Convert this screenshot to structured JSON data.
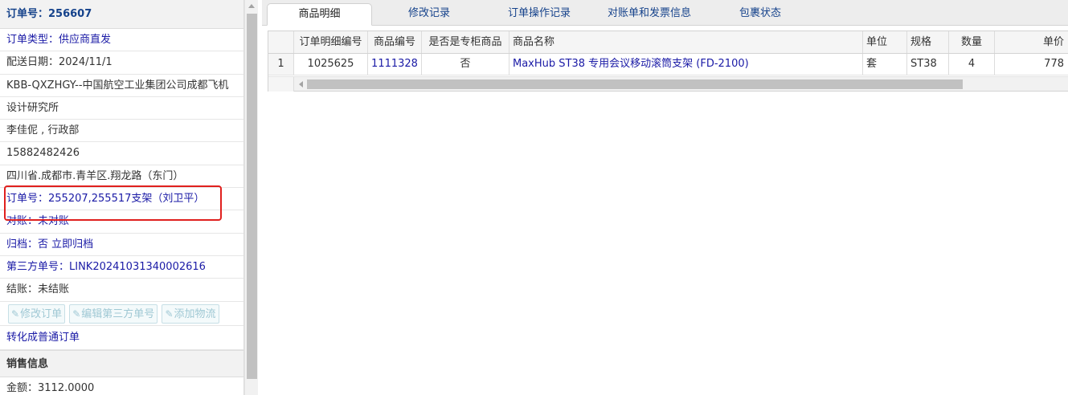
{
  "left_panel": {
    "order_header": "订单号：256607",
    "order_type": "订单类型：供应商直发",
    "delivery_date": "配送日期：2024/11/1",
    "customer_line1": "KBB-QXZHGY--中国航空工业集团公司成都飞机",
    "customer_line2": "设计研究所",
    "contact": "李佳伲 , 行政部",
    "phone": "15882482426",
    "address": "四川省.成都市.青羊区.翔龙路（东门）",
    "related_orders": "订单号：255207,255517支架（刘卫平）",
    "reconcile_label": "对账：",
    "reconcile_value": "未对账",
    "archive_label": "归档：",
    "archive_value": "否",
    "archive_action": "立即归档",
    "third_party_no": "第三方单号：LINK20241031340002616",
    "settlement": "结账：未结账",
    "buttons": {
      "edit_order": "修改订单",
      "edit_third_party": "编辑第三方单号",
      "add_logistics": "添加物流"
    },
    "convert_link": "转化成普通订单",
    "sales_section_title": "销售信息",
    "amount": "金额：3112.0000"
  },
  "tabs": [
    {
      "label": "商品明细",
      "active": true
    },
    {
      "label": "修改记录",
      "active": false
    },
    {
      "label": "订单操作记录",
      "active": false
    },
    {
      "label": "对账单和发票信息",
      "active": false
    },
    {
      "label": "包裹状态",
      "active": false
    }
  ],
  "grid": {
    "columns": [
      "",
      "订单明细编号",
      "商品编号",
      "是否是专柜商品",
      "商品名称",
      "单位",
      "规格",
      "数量",
      "单价"
    ],
    "rows": [
      {
        "row_num": "1",
        "detail_id": "1025625",
        "product_id": "1111328",
        "is_counter": "否",
        "product_name": "MaxHub ST38 专用会议移动滚筒支架 (FD-2100)",
        "unit": "套",
        "spec": "ST38",
        "quantity": "4",
        "unit_price": "778"
      }
    ]
  },
  "icons": {
    "edit": "pencil-icon",
    "scroll_up": "arrow-up-icon",
    "scroll_left": "arrow-left-icon"
  },
  "colors": {
    "link_blue": "#1a1aa6",
    "highlight_red": "#e0201e",
    "disabled_button_text": "#9fc8d4"
  }
}
